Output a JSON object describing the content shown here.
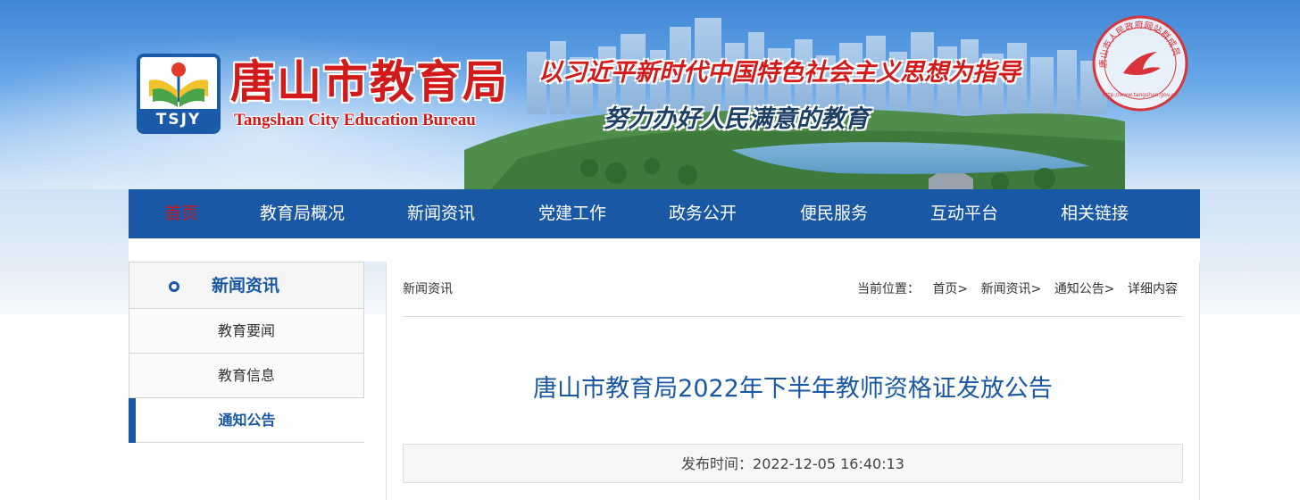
{
  "header": {
    "logo_text": "TSJY",
    "title_cn": "唐山市教育局",
    "title_en": "Tangshan City Education Bureau",
    "slogan_1": "以习近平新时代中国特色社会主义思想为指导",
    "slogan_2": "努力办好人民满意的教育",
    "seal_text": "唐山市人民政府网站群成员",
    "seal_url": "http://www.tangshan.gov.cn"
  },
  "nav": {
    "items": [
      {
        "label": "首页",
        "active": true
      },
      {
        "label": "教育局概况"
      },
      {
        "label": "新闻资讯"
      },
      {
        "label": "党建工作"
      },
      {
        "label": "政务公开"
      },
      {
        "label": "便民服务"
      },
      {
        "label": "互动平台"
      },
      {
        "label": "相关链接"
      }
    ]
  },
  "sidebar": {
    "title": "新闻资讯",
    "items": [
      {
        "label": "教育要闻"
      },
      {
        "label": "教育信息"
      },
      {
        "label": "通知公告",
        "active": true
      }
    ]
  },
  "breadcrumb": {
    "section": "新闻资讯",
    "location_label": "当前位置：",
    "path": [
      "首页>",
      "新闻资讯>",
      "通知公告>",
      "详细内容"
    ]
  },
  "article": {
    "title": "唐山市教育局2022年下半年教师资格证发放公告",
    "publish_label": "发布时间：",
    "publish_time": "2022-12-05 16:40:13",
    "publish_line": "发布时间：2022-12-05 16:40:13"
  },
  "colors": {
    "nav_bg": "#1858a5",
    "nav_active": "#c8161d",
    "title_red": "#d21a1a",
    "link_blue": "#1858a5"
  }
}
